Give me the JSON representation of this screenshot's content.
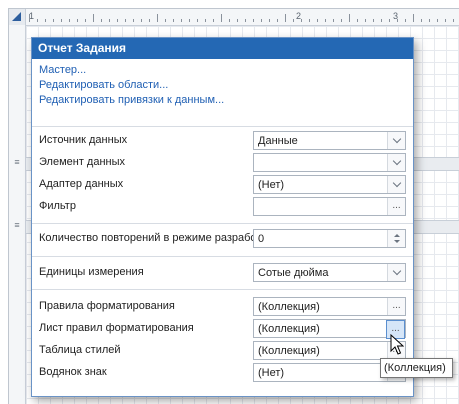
{
  "ruler": {
    "numbers": [
      "1",
      "2",
      "3"
    ]
  },
  "panel": {
    "title": "Отчет Задания",
    "links": [
      "Мастер...",
      "Редактировать области...",
      "Редактировать привязки к данным..."
    ],
    "properties": [
      {
        "label": "Источник данных",
        "value": "Данные",
        "editor": "dropdown"
      },
      {
        "label": "Элемент данных",
        "value": "",
        "editor": "dropdown"
      },
      {
        "label": "Адаптер данных",
        "value": "(Нет)",
        "editor": "dropdown"
      },
      {
        "label": "Фильтр",
        "value": "",
        "editor": "ellipsis",
        "ellipsis": "..."
      },
      {
        "label": "Количество повторений в режиме разработки",
        "value": "0",
        "editor": "spin"
      },
      {
        "label": "Единицы измерения",
        "value": "Сотые дюйма",
        "editor": "dropdown"
      },
      {
        "label": "Правила форматирования",
        "value": "(Коллекция)",
        "editor": "ellipsis",
        "ellipsis": "..."
      },
      {
        "label": "Лист правил форматирования",
        "value": "(Коллекция)",
        "editor": "ellipsis",
        "ellipsis": "..."
      },
      {
        "label": "Таблица стилей",
        "value": "(Коллекция)",
        "editor": "ellipsis",
        "ellipsis": "..."
      },
      {
        "label": "Водянок знак",
        "value": "(Нет)",
        "editor": "ellipsis",
        "ellipsis": "..."
      }
    ]
  },
  "tooltip": {
    "text": "(Коллекция)"
  },
  "colors": {
    "header": "#2468b4",
    "link": "#1f5fb3",
    "border": "#6a93c6"
  }
}
